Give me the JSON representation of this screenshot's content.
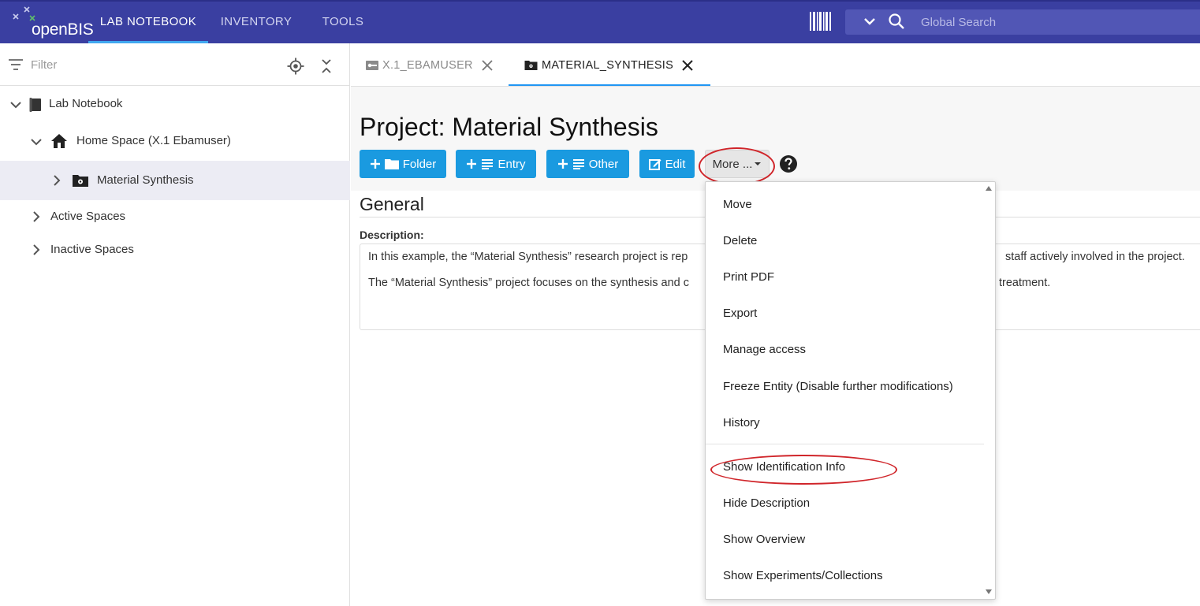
{
  "app": {
    "logo_text": "openBIS",
    "nav": [
      "LAB NOTEBOOK",
      "INVENTORY",
      "TOOLS"
    ],
    "search_placeholder": "Global Search"
  },
  "sidebar": {
    "filter_placeholder": "Filter",
    "tree": [
      {
        "label": "Lab Notebook",
        "level": 0,
        "expanded": true,
        "icon": "notebook-icon"
      },
      {
        "label": "Home Space (X.1 Ebamuser)",
        "level": 1,
        "expanded": true,
        "icon": "home-icon"
      },
      {
        "label": "Material Synthesis",
        "level": 2,
        "expanded": false,
        "selected": true,
        "icon": "project-folder-icon"
      },
      {
        "label": "Active Spaces",
        "level": 0,
        "expanded": false
      },
      {
        "label": "Inactive Spaces",
        "level": 0,
        "expanded": false
      }
    ]
  },
  "tabs": [
    {
      "label": "X.1_EBAMUSER",
      "active": false,
      "icon": "space-icon"
    },
    {
      "label": "MATERIAL_SYNTHESIS",
      "active": true,
      "icon": "project-icon"
    }
  ],
  "page": {
    "title": "Project: Material Synthesis",
    "buttons": {
      "folder": "Folder",
      "entry": "Entry",
      "other": "Other",
      "edit": "Edit",
      "more": "More ..."
    },
    "section_title": "General",
    "description_label": "Description:",
    "description_p1_start": "In this example, the “Material Synthesis” research project is rep",
    "description_p1_end": "staff actively involved in the project.",
    "description_p2_start": "The “Material Synthesis” project focuses on the synthesis and c",
    "description_p2_end": "treatment."
  },
  "more_menu": {
    "items": [
      "Move",
      "Delete",
      "Print PDF",
      "Export",
      "Manage access",
      "Freeze Entity (Disable further modifications)",
      "History",
      "Show Identification Info",
      "Hide Description",
      "Show Overview",
      "Show Experiments/Collections"
    ],
    "highlighted": "Show Identification Info"
  },
  "colors": {
    "topbar": "#3a3fa1",
    "accent_blue": "#1a9ae0",
    "nav_active_underline": "#41a8f0",
    "annotation_red": "#d0252a"
  }
}
